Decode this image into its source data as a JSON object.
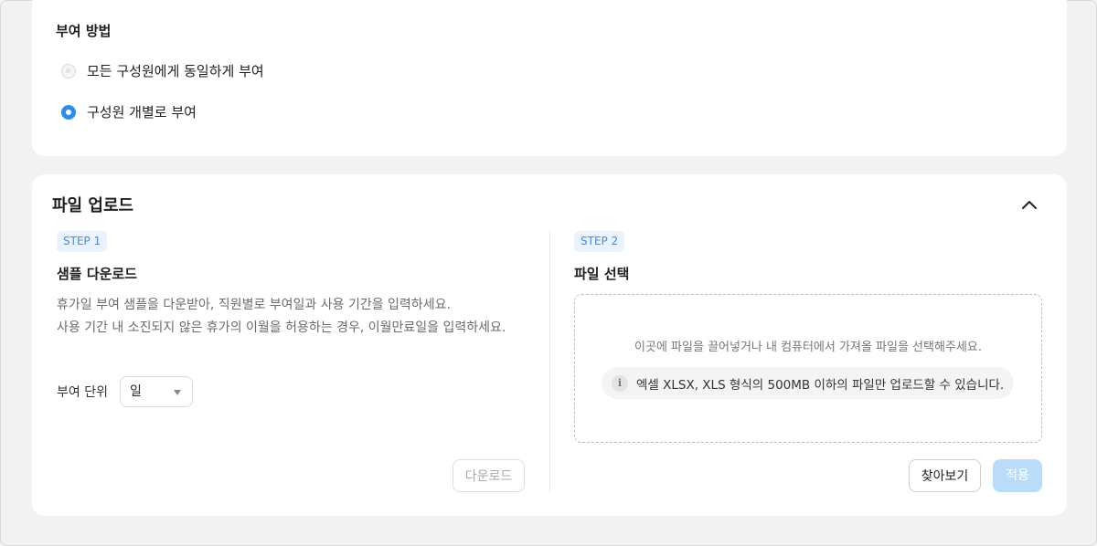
{
  "grant_method": {
    "label": "부여 방법",
    "options": [
      {
        "label": "모든 구성원에게 동일하게 부여",
        "selected": false
      },
      {
        "label": "구성원 개별로 부여",
        "selected": true
      }
    ]
  },
  "upload": {
    "title": "파일 업로드",
    "collapse_icon": "chevron-up-icon",
    "step1": {
      "badge": "STEP 1",
      "title": "샘플 다운로드",
      "desc_line1": "휴가일 부여 샘플을 다운받아, 직원별로 부여일과 사용 기간을 입력하세요.",
      "desc_line2": "사용 기간 내 소진되지 않은 휴가의 이월을 허용하는 경우, 이월만료일을 입력하세요.",
      "unit_label": "부여 단위",
      "unit_value": "일",
      "download_button": "다운로드"
    },
    "step2": {
      "badge": "STEP 2",
      "title": "파일 선택",
      "drop_text": "이곳에 파일을 끌어넣거나 내 컴퓨터에서 가져올 파일을 선택해주세요.",
      "info_icon": "i",
      "info_text": "엑셀 XLSX, XLS 형식의 500MB 이하의 파일만 업로드할 수 있습니다.",
      "browse_button": "찾아보기",
      "apply_button": "적용"
    }
  },
  "colors": {
    "accent": "#2b8cf4",
    "badge_bg": "#e8f3ff",
    "apply_disabled": "#b9dcfb"
  }
}
